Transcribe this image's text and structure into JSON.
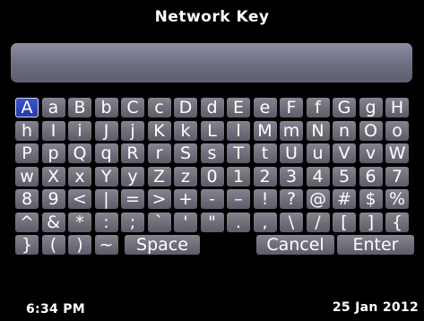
{
  "title": "Network Key",
  "input": {
    "value": ""
  },
  "keyboard": {
    "selected": "A",
    "rows": [
      [
        "A",
        "a",
        "B",
        "b",
        "C",
        "c",
        "D",
        "d",
        "E",
        "e",
        "F",
        "f",
        "G",
        "g",
        "H"
      ],
      [
        "h",
        "I",
        "i",
        "J",
        "j",
        "K",
        "k",
        "L",
        "l",
        "M",
        "m",
        "N",
        "n",
        "O",
        "o"
      ],
      [
        "P",
        "p",
        "Q",
        "q",
        "R",
        "r",
        "S",
        "s",
        "T",
        "t",
        "U",
        "u",
        "V",
        "v",
        "W"
      ],
      [
        "w",
        "X",
        "x",
        "Y",
        "y",
        "Z",
        "z",
        "0",
        "1",
        "2",
        "3",
        "4",
        "5",
        "6",
        "7"
      ],
      [
        "8",
        "9",
        "<",
        "|",
        "=",
        ">",
        "+",
        "-",
        "–",
        "!",
        "?",
        "@",
        "#",
        "$",
        "%"
      ],
      [
        "^",
        "&",
        "*",
        ":",
        ";",
        "`",
        "'",
        "\"",
        ".",
        ",",
        "\\",
        "/",
        "[",
        "]",
        "{"
      ],
      [
        "}",
        "(",
        ")",
        "~"
      ]
    ],
    "space_label": "Space",
    "cancel_label": "Cancel",
    "enter_label": "Enter"
  },
  "status": {
    "time": "6:34 PM",
    "date": "25 Jan 2012"
  },
  "colors": {
    "background": "#000000",
    "key": "#6e6e7a",
    "key_selected": "#2539a8",
    "entry": "#6b6b80"
  }
}
